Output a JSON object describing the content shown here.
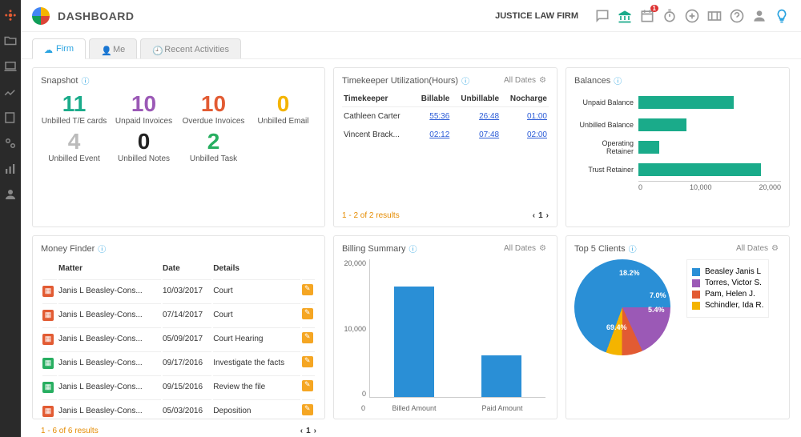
{
  "header": {
    "title": "DASHBOARD",
    "firm": "JUSTICE LAW FIRM",
    "calendar_badge": "1"
  },
  "tabs": [
    {
      "label": "Firm",
      "active": true
    },
    {
      "label": "Me",
      "active": false
    },
    {
      "label": "Recent Activities",
      "active": false
    }
  ],
  "snapshot": {
    "title": "Snapshot",
    "items": [
      {
        "value": "11",
        "label": "Unbilled T/E cards",
        "color": "c-teal"
      },
      {
        "value": "10",
        "label": "Unpaid Invoices",
        "color": "c-purple"
      },
      {
        "value": "10",
        "label": "Overdue Invoices",
        "color": "c-orange"
      },
      {
        "value": "0",
        "label": "Unbilled Email",
        "color": "c-yellow"
      },
      {
        "value": "4",
        "label": "Unbilled Event",
        "color": "c-grey"
      },
      {
        "value": "0",
        "label": "Unbilled Notes",
        "color": "c-black"
      },
      {
        "value": "2",
        "label": "Unbilled Task",
        "color": "c-green"
      }
    ]
  },
  "timekeeper": {
    "title": "Timekeeper Utilization(Hours)",
    "filter": "All Dates",
    "columns": [
      "Timekeeper",
      "Billable",
      "Unbillable",
      "Nocharge"
    ],
    "rows": [
      {
        "name": "Cathleen Carter",
        "billable": "55:36",
        "unbillable": "26:48",
        "nocharge": "01:00"
      },
      {
        "name": "Vincent Brack...",
        "billable": "02:12",
        "unbillable": "07:48",
        "nocharge": "02:00"
      }
    ],
    "pager": "1 - 2 of 2 results",
    "page": "1"
  },
  "balances": {
    "title": "Balances",
    "items": [
      {
        "label": "Unpaid Balance",
        "value": 14000
      },
      {
        "label": "Unbilled Balance",
        "value": 7000
      },
      {
        "label": "Operating Retainer",
        "value": 3000
      },
      {
        "label": "Trust Retainer",
        "value": 18000
      }
    ],
    "axis": [
      "0",
      "10,000",
      "20,000"
    ],
    "max": 20000
  },
  "moneyfinder": {
    "title": "Money Finder",
    "columns": [
      "Matter",
      "Date",
      "Details"
    ],
    "rows": [
      {
        "icon": "red",
        "matter": "Janis L Beasley-Cons...",
        "date": "10/03/2017",
        "details": "Court"
      },
      {
        "icon": "red",
        "matter": "Janis L Beasley-Cons...",
        "date": "07/14/2017",
        "details": "Court"
      },
      {
        "icon": "red",
        "matter": "Janis L Beasley-Cons...",
        "date": "05/09/2017",
        "details": "Court Hearing"
      },
      {
        "icon": "green",
        "matter": "Janis L Beasley-Cons...",
        "date": "09/17/2016",
        "details": "Investigate the facts"
      },
      {
        "icon": "green",
        "matter": "Janis L Beasley-Cons...",
        "date": "09/15/2016",
        "details": "Review the file"
      },
      {
        "icon": "red",
        "matter": "Janis L Beasley-Cons...",
        "date": "05/03/2016",
        "details": "Deposition"
      }
    ],
    "pager": "1 - 6 of 6 results",
    "page": "1"
  },
  "billing": {
    "title": "Billing Summary",
    "filter": "All Dates"
  },
  "topclients": {
    "title": "Top 5 Clients",
    "filter": "All Dates",
    "legend": [
      {
        "label": "Beasley Janis L",
        "color": "#2a8fd6"
      },
      {
        "label": "Torres, Victor S.",
        "color": "#9b59b6"
      },
      {
        "label": "Pam, Helen J.",
        "color": "#e25b33"
      },
      {
        "label": "Schindler, Ida R.",
        "color": "#f4b400"
      }
    ]
  },
  "chart_data": [
    {
      "id": "balances",
      "type": "bar",
      "orientation": "horizontal",
      "categories": [
        "Unpaid Balance",
        "Unbilled Balance",
        "Operating Retainer",
        "Trust Retainer"
      ],
      "values": [
        14000,
        7000,
        3000,
        18000
      ],
      "xlim": [
        0,
        20000
      ],
      "xticks": [
        0,
        10000,
        20000
      ]
    },
    {
      "id": "billing_summary",
      "type": "bar",
      "categories": [
        "Billed Amount",
        "Paid Amount"
      ],
      "values": [
        16000,
        6000
      ],
      "ylim": [
        0,
        20000
      ],
      "yticks": [
        0,
        10000,
        20000
      ],
      "xtick_zero": "0"
    },
    {
      "id": "top5_clients",
      "type": "pie",
      "series": [
        {
          "name": "Beasley Janis L",
          "value": 69.4,
          "color": "#2a8fd6"
        },
        {
          "name": "Torres, Victor S.",
          "value": 18.2,
          "color": "#9b59b6"
        },
        {
          "name": "Pam, Helen J.",
          "value": 7.0,
          "color": "#e25b33"
        },
        {
          "name": "Schindler, Ida R.",
          "value": 5.4,
          "color": "#f4b400"
        }
      ],
      "labels_shown": [
        "69.4%",
        "18.2%",
        "7.0%",
        "5.4%"
      ]
    }
  ]
}
